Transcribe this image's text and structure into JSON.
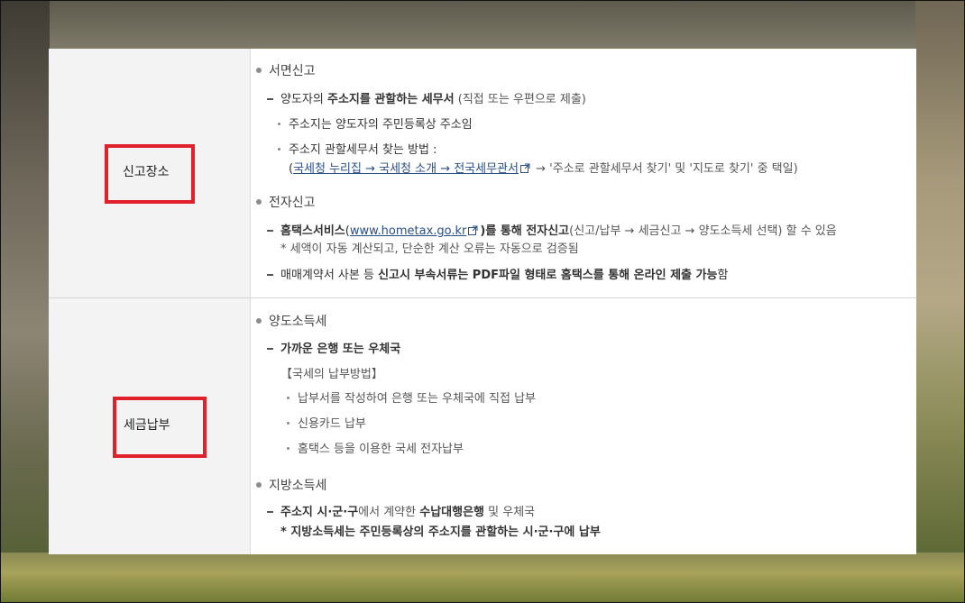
{
  "row1": {
    "label": "신고장소",
    "written": {
      "title": "서면신고",
      "main_a": "양도자의 ",
      "main_b": "주소지를 관할하는 세무서",
      "main_c": " (직접 또는 우편으로 제출)",
      "sub1": "주소지는 양도자의 주민등록상 주소임",
      "sub2_title": "주소지 관할세무서 찾는 방법 :",
      "sub2_open": "(",
      "sub2_link": "국세청 누리집 → 국세청 소개 → 전국세무관서",
      "sub2_rest": " → '주소로 관할세무서 찾기' 및 '지도로 찾기' 중 택일)"
    },
    "electronic": {
      "title": "전자신고",
      "line1_a": "홈택스서비스",
      "line1_b": "(",
      "line1_link": "www.hometax.go.kr",
      "line1_c": ")를 통해 전자신고",
      "line1_d": "(신고/납부 → 세금신고 → 양도소득세 선택) 할 수 있음",
      "note": "* 세액이 자동 계산되고, 단순한 계산 오류는 자동으로 검증됨",
      "line2_a": "매매계약서 사본 등 ",
      "line2_b": "신고시 부속서류는 PDF파일 형태로 홈택스를 통해 온라인 제출 가능",
      "line2_c": "함"
    }
  },
  "row2": {
    "label": "세금납부",
    "capital_gains": {
      "title": "양도소득세",
      "main": "가까운 은행 또는 우체국",
      "method_title": "【국세의 납부방법】",
      "methods": [
        "납부서를 작성하여 은행 또는 우체국에 직접 납부",
        "신용카드 납부",
        "홈택스 등을 이용한 국세 전자납부"
      ]
    },
    "local_income": {
      "title": "지방소득세",
      "main_a": "주소지 시·군·구",
      "main_b": "에서 계약한 ",
      "main_c": "수납대행은행",
      "main_d": " 및 우체국",
      "note": "* 지방소득세는 주민등록상의 주소지를 관할하는 시·군·구에 납부"
    }
  },
  "colors": {
    "highlight_box": "#e0202a",
    "link": "#2a4f86",
    "header_bg": "#f3f3f3"
  }
}
